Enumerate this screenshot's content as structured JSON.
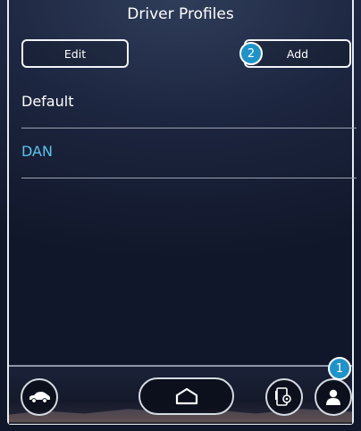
{
  "header": {
    "title": "Driver Profiles"
  },
  "toolbar": {
    "edit_label": "Edit",
    "add_label": "Add"
  },
  "callouts": {
    "add_badge": "2",
    "profile_badge": "1"
  },
  "profiles": [
    {
      "name": "Default",
      "selected": false
    },
    {
      "name": "DAN",
      "selected": true
    }
  ],
  "dock": {
    "icons": [
      "car-icon",
      "home-icon",
      "phone-settings-icon",
      "person-icon"
    ]
  },
  "colors": {
    "accent": "#1f93c7",
    "selected_text": "#5bc4ec",
    "background": "#1d2640"
  }
}
